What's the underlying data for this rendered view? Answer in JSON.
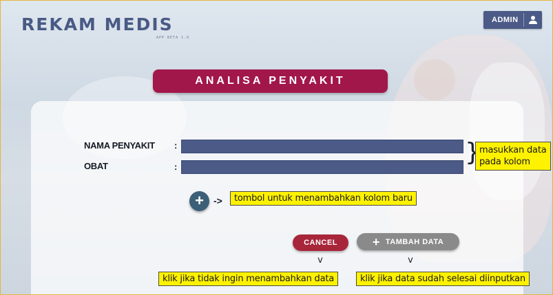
{
  "brand": {
    "title": "REKAM MEDIS",
    "subtitle": "APP BETA 1.0"
  },
  "header": {
    "admin_label": "ADMIN",
    "user_icon": "user-icon"
  },
  "page": {
    "title": "ANALISA PENYAKIT"
  },
  "form": {
    "fields": [
      {
        "label": "NAMA PENYAKIT",
        "colon": ":",
        "value": ""
      },
      {
        "label": "OBAT",
        "colon": ":",
        "value": ""
      }
    ],
    "add_column_symbol": "+",
    "arrow": "->"
  },
  "notes": {
    "fields_hint": [
      "masukkan data",
      "pada kolom"
    ],
    "add_column_hint": "tombol untuk menambahkan kolom baru",
    "cancel_hint": "klik jika tidak ingin menambahkan data",
    "tambah_hint": "klik jika data sudah selesai diinputkan"
  },
  "actions": {
    "cancel_label": "CANCEL",
    "tambah_label": "TAMBAH DATA",
    "tambah_icon": "plus-icon"
  },
  "colors": {
    "primary": "#4b5a86",
    "title_pill": "#a2174a",
    "cancel": "#a8263a",
    "tambah": "#8a8a8a",
    "note_bg": "#fff200"
  }
}
